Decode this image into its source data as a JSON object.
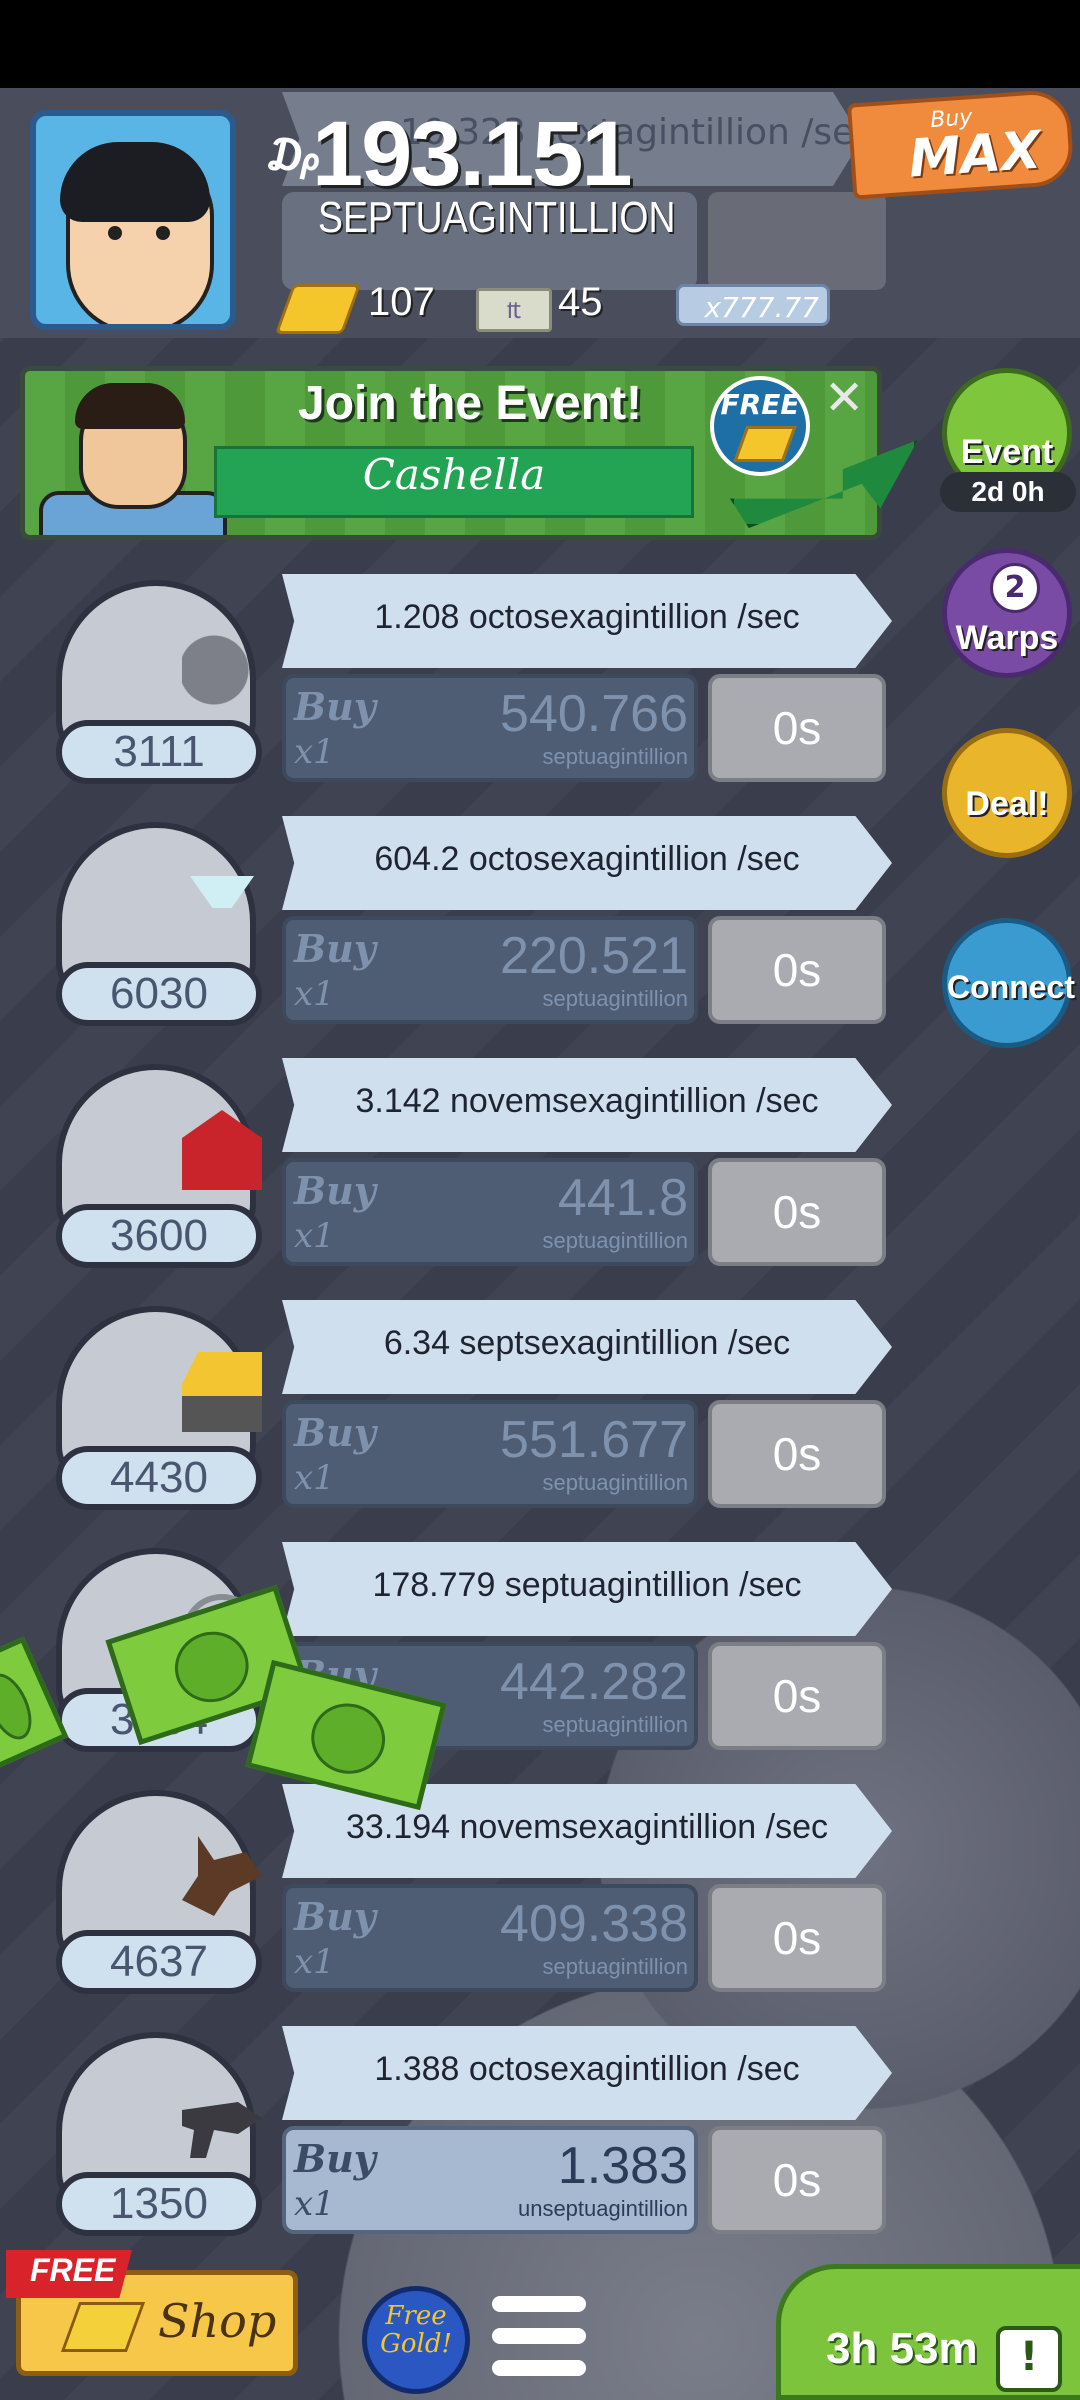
{
  "header": {
    "currency_symbol": "₯",
    "money_amount": "193.151",
    "money_unit": "SEPTUAGINTILLION",
    "gold_count": "107",
    "megabucks_count": "45",
    "multiplier": "x777.77",
    "buy_max_small": "Buy",
    "buy_max_big": "MAX",
    "ghost_rate": "10.323 sextagintillion /sec"
  },
  "event": {
    "title": "Join the Event!",
    "name": "Cashella",
    "free_label": "FREE",
    "close_label": "✕"
  },
  "side": {
    "event_label": "Event",
    "event_timer": "2d 0h",
    "warps_count": "2",
    "warps_label": "Warps",
    "deal_label": "Deal!",
    "connect_label": "Connect"
  },
  "businesses": [
    {
      "count": "3111",
      "rate": "1.208 octosexagintillion /sec",
      "buy": "Buy",
      "mult": "x1",
      "cost": "540.766",
      "cost_unit": "septuagintillion",
      "timer": "0s",
      "icon": "moon-rocket-icon"
    },
    {
      "count": "6030",
      "rate": "604.2 octosexagintillion /sec",
      "buy": "Buy",
      "mult": "x1",
      "cost": "220.521",
      "cost_unit": "septuagintillion",
      "timer": "0s",
      "icon": "cocktail-glass-icon"
    },
    {
      "count": "3600",
      "rate": "3.142 novemsexagintillion /sec",
      "buy": "Buy",
      "mult": "x1",
      "cost": "441.8",
      "cost_unit": "septuagintillion",
      "timer": "0s",
      "icon": "barn-icon"
    },
    {
      "count": "4430",
      "rate": "6.34 septsexagintillion /sec",
      "buy": "Buy",
      "mult": "x1",
      "cost": "551.677",
      "cost_unit": "septuagintillion",
      "timer": "0s",
      "icon": "cheese-cart-icon"
    },
    {
      "count": "3184",
      "rate": "178.779 septuagintillion /sec",
      "buy": "Buy",
      "mult": "x1",
      "cost": "442.282",
      "cost_unit": "septuagintillion",
      "timer": "0s",
      "icon": "amusement-park-icon"
    },
    {
      "count": "4637",
      "rate": "33.194 novemsexagintillion /sec",
      "buy": "Buy",
      "mult": "x1",
      "cost": "409.338",
      "cost_unit": "septuagintillion",
      "timer": "0s",
      "icon": "werewolf-icon"
    },
    {
      "count": "1350",
      "rate": "1.388 octosexagintillion /sec",
      "buy": "Buy",
      "mult": "x1",
      "cost": "1.383",
      "cost_unit": "unseptuagintillion",
      "timer": "0s",
      "icon": "ray-gun-icon"
    }
  ],
  "bottom": {
    "free_ribbon": "FREE",
    "shop_label": "Shop",
    "free_gold": "Free Gold!",
    "timer": "3h 53m",
    "alert": "!"
  },
  "colors": {
    "background": "#3d4150",
    "rate_bar": "#cfdfee",
    "event_green": "#4f9a3b",
    "buy_max_orange": "#f08a3c"
  }
}
